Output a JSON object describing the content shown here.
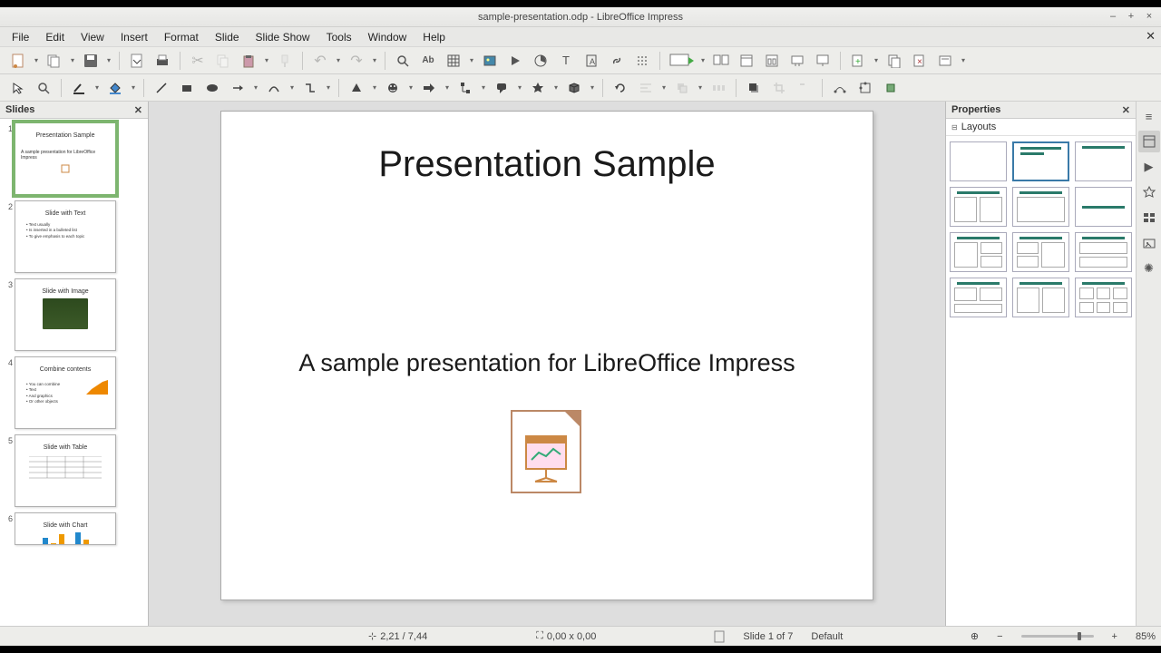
{
  "window": {
    "title": "sample-presentation.odp - LibreOffice Impress"
  },
  "menu": {
    "items": [
      "File",
      "Edit",
      "View",
      "Insert",
      "Format",
      "Slide",
      "Slide Show",
      "Tools",
      "Window",
      "Help"
    ]
  },
  "panels": {
    "slides": {
      "title": "Slides"
    },
    "properties": {
      "title": "Properties",
      "section": "Layouts"
    }
  },
  "slides": [
    {
      "title": "Presentation Sample",
      "subtitle": "A sample presentation for LibreOffice Impress"
    },
    {
      "title": "Slide with Text",
      "bullets": [
        "Text usually",
        "Is inserted in a bulleted list",
        "To give emphasis to each topic"
      ]
    },
    {
      "title": "Slide with Image"
    },
    {
      "title": "Combine contents",
      "bullets": [
        "You can combine",
        "Text",
        "And graphics",
        "Or other objects"
      ]
    },
    {
      "title": "Slide with Table"
    },
    {
      "title": "Slide with Chart"
    }
  ],
  "current_slide": {
    "title": "Presentation Sample",
    "subtitle": "A sample presentation for LibreOffice Impress"
  },
  "status": {
    "pos": "2,21 / 7,44",
    "size": "0,00 x 0,00",
    "slide": "Slide 1 of 7",
    "master": "Default",
    "zoom": "85%"
  }
}
